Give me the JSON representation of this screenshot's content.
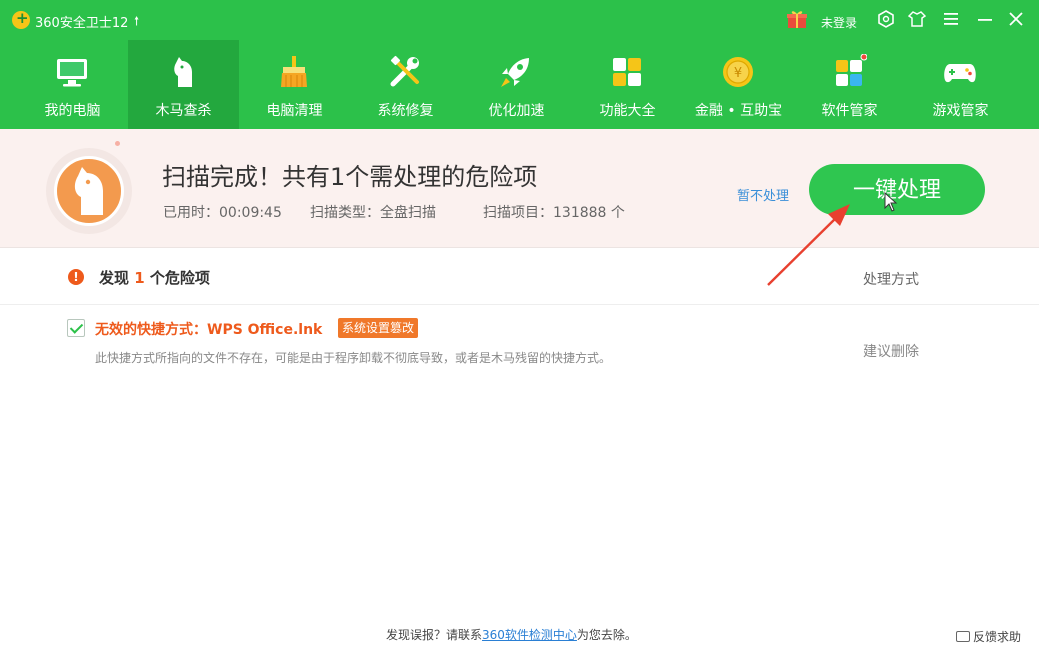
{
  "app": {
    "title": "360安全卫士12",
    "upgrade_icon": "arrow-up",
    "login_label": "未登录"
  },
  "titlebar_icons": [
    "gift-icon",
    "settings-hex-icon",
    "skin-shirt-icon",
    "menu-icon",
    "minimize-icon",
    "close-icon"
  ],
  "nav": {
    "items": [
      {
        "label": "我的电脑",
        "icon": "monitor-icon"
      },
      {
        "label": "木马查杀",
        "icon": "horse-icon",
        "active": true
      },
      {
        "label": "电脑清理",
        "icon": "broom-icon"
      },
      {
        "label": "系统修复",
        "icon": "tools-icon"
      },
      {
        "label": "优化加速",
        "icon": "rocket-icon"
      },
      {
        "label": "功能大全",
        "icon": "grid-icon"
      },
      {
        "label": "金融 • 互助宝",
        "icon": "coin-icon"
      },
      {
        "label": "软件管家",
        "icon": "apps-icon"
      },
      {
        "label": "游戏管家",
        "icon": "gamepad-icon"
      }
    ]
  },
  "scan": {
    "title": "扫描完成！共有1个需处理的危险项",
    "elapsed": "已用时：00:09:45",
    "type": "扫描类型：全盘扫描",
    "items": "扫描项目：131888 个",
    "skip_label": "暂不处理",
    "fix_label": "一键处理"
  },
  "results": {
    "found_prefix": "发现",
    "found_count": "1",
    "found_suffix": "个危险项",
    "handle_column": "处理方式",
    "items": [
      {
        "title": "无效的快捷方式：WPS Office.lnk",
        "tag": "系统设置篡改",
        "description": "此快捷方式所指向的文件不存在，可能是由于程序卸载不彻底导致，或者是木马残留的快捷方式。",
        "action": "建议删除",
        "checked": true
      }
    ]
  },
  "footer": {
    "prefix": "发现误报？请联系",
    "link": "360软件检测中心",
    "suffix": "为您去除。",
    "feedback": "反馈求助"
  },
  "colors": {
    "header_green": "#2cc14a",
    "active_tab": "#23a83e",
    "danger_orange": "#ee5a1c",
    "banner_bg": "#fbf1ef",
    "link_blue": "#2a7fd4"
  }
}
